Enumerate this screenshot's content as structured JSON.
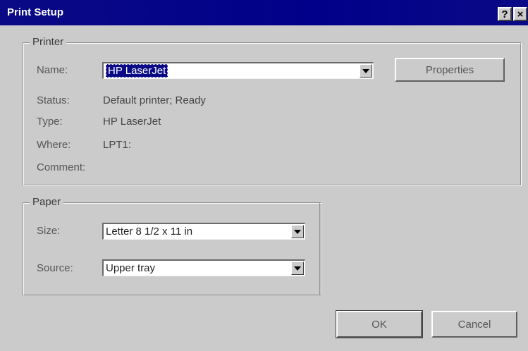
{
  "window": {
    "title": "Print Setup",
    "help_glyph": "?",
    "close_glyph": "×"
  },
  "printer": {
    "group_label": "Printer",
    "name_label": "Name:",
    "name_value": "HP LaserJet",
    "properties_label": "Properties",
    "status_label": "Status:",
    "status_value": "Default printer; Ready",
    "type_label": "Type:",
    "type_value": "HP LaserJet",
    "where_label": "Where:",
    "where_value": "LPT1:",
    "comment_label": "Comment:"
  },
  "paper": {
    "group_label": "Paper",
    "size_label": "Size:",
    "size_value": "Letter 8 1/2 x 11 in",
    "source_label": "Source:",
    "source_value": "Upper tray"
  },
  "buttons": {
    "ok": "OK",
    "cancel": "Cancel"
  },
  "icons": {
    "dropdown": "chevron-down-icon"
  },
  "colors": {
    "titlebar": "#0a0a86",
    "dialog_bg": "#cbcbcb",
    "selection": "#0a0a86"
  }
}
